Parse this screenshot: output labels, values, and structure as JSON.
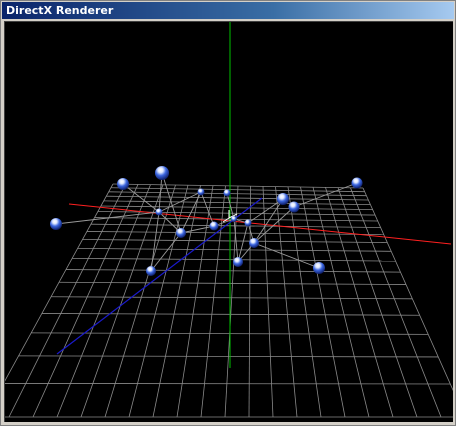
{
  "window": {
    "title": "DirectX Renderer"
  },
  "scene": {
    "background": "#000000",
    "grid_color": "#8a8a8a",
    "axis_colors": {
      "x": "#ff2020",
      "y": "#00c000",
      "z": "#1a1acc"
    },
    "node_color": "#3b66e0",
    "highlight_color": "#ffffff",
    "link_color": "#9a9a9a"
  }
}
